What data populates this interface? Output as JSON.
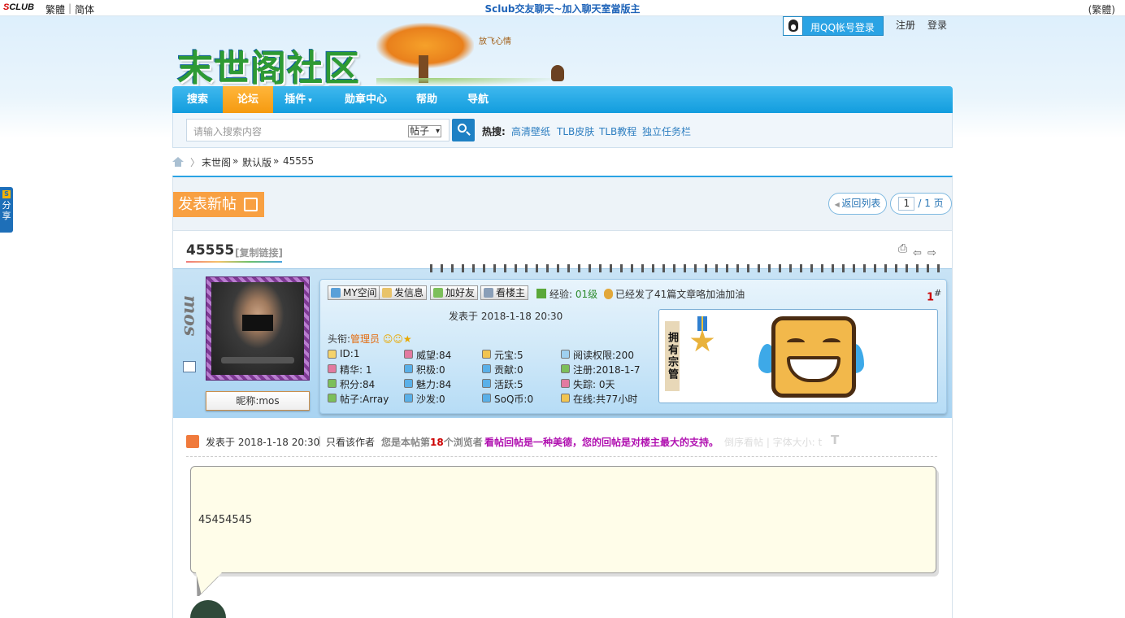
{
  "topbar": {
    "brand_a": "S",
    "brand_b": "CLUB",
    "lang_trad": "繁體",
    "lang_simp": "简体",
    "center": "Sclub交友聊天~加入聊天室當版主",
    "right": "(繁體)"
  },
  "account": {
    "qq_login": "用QQ帐号登录",
    "register": "注册",
    "login": "登录"
  },
  "logo": {
    "text": "末世阁社区",
    "tagline": "放飞心情"
  },
  "nav": {
    "items": [
      "搜索",
      "论坛",
      "插件",
      "勋章中心",
      "帮助",
      "导航"
    ],
    "active": "论坛"
  },
  "search": {
    "placeholder": "请输入搜索内容",
    "type": "帖子",
    "hot_label": "热搜:",
    "hot": [
      "高清壁纸",
      "TLB皮肤",
      "TLB教程",
      "独立任务栏"
    ]
  },
  "breadcrumb": {
    "items": [
      "末世阁",
      "默认版",
      "45555"
    ],
    "sep": "»"
  },
  "toolbar": {
    "new_post": "发表新帖",
    "back": "返回列表",
    "page_current": "1",
    "page_total": "/ 1 页"
  },
  "thread": {
    "title": "45555",
    "copy_link": "[复制链接]"
  },
  "author": {
    "vertical_name": "mos",
    "nickname": "昵称:mos"
  },
  "post_actions": [
    "MY空间",
    "发信息",
    "加好友",
    "看楼主"
  ],
  "exp": {
    "label": "经验:",
    "level": "01级",
    "note": "已经发了41篇文章咯加油加油"
  },
  "floor": {
    "num": "1",
    "mark": "#"
  },
  "post_time": "发表于 2018-1-18 20:30",
  "rank": {
    "label": "头衔:",
    "value": "管理员"
  },
  "stats": [
    [
      "ID:1",
      "威望:84",
      "元宝:5",
      "阅读权限:200"
    ],
    [
      "精华: 1",
      "积极:0",
      "贡献:0",
      "注册:2018-1-7"
    ],
    [
      "积分:84",
      "魅力:84",
      "活跃:5",
      "失踪: 0天"
    ],
    [
      "帖子:Array",
      "沙发:0",
      "SoQ币:0",
      "在线:共77小时"
    ]
  ],
  "medal_label": "拥有宗管",
  "meta": {
    "time": "发表于 2018-1-18 20:30",
    "sep": "|",
    "only_author": "只看该作者",
    "views_pre": "您是本帖第",
    "views_num": "18",
    "views_post": "个浏览者",
    "slogan": "看帖回帖是一种美德，您的回帖是对楼主最大的支持。",
    "faded": "倒序看帖 | 字体大小: t",
    "big_t": "T"
  },
  "post_body": "45454545",
  "side_share": "分享",
  "colors": {
    "nav": "#129dde",
    "accent": "#f8a042",
    "link": "#2d7ec0",
    "admin": "#e36b0d"
  }
}
